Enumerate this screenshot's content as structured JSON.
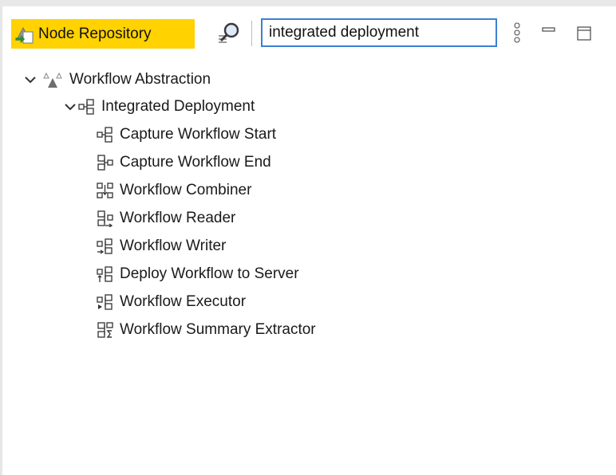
{
  "toolbar": {
    "tab_label": "Node Repository",
    "search_value": "integrated deployment",
    "accent": "#ffd200",
    "input_border": "#3d7fd1"
  },
  "tree": {
    "category": {
      "label": "Workflow Abstraction",
      "icon": "category-triangles-icon",
      "expanded": true
    },
    "subcategory": {
      "label": "Integrated Deployment",
      "icon": "workflow-node-icon",
      "expanded": true
    },
    "nodes": [
      {
        "label": "Capture Workflow Start",
        "icon": "capture-start-icon"
      },
      {
        "label": "Capture Workflow End",
        "icon": "capture-end-icon"
      },
      {
        "label": "Workflow Combiner",
        "icon": "combiner-icon"
      },
      {
        "label": "Workflow Reader",
        "icon": "reader-icon"
      },
      {
        "label": "Workflow Writer",
        "icon": "writer-icon"
      },
      {
        "label": "Deploy Workflow to Server",
        "icon": "deploy-icon"
      },
      {
        "label": "Workflow Executor",
        "icon": "executor-icon"
      },
      {
        "label": "Workflow Summary Extractor",
        "icon": "summary-extractor-icon"
      }
    ]
  }
}
